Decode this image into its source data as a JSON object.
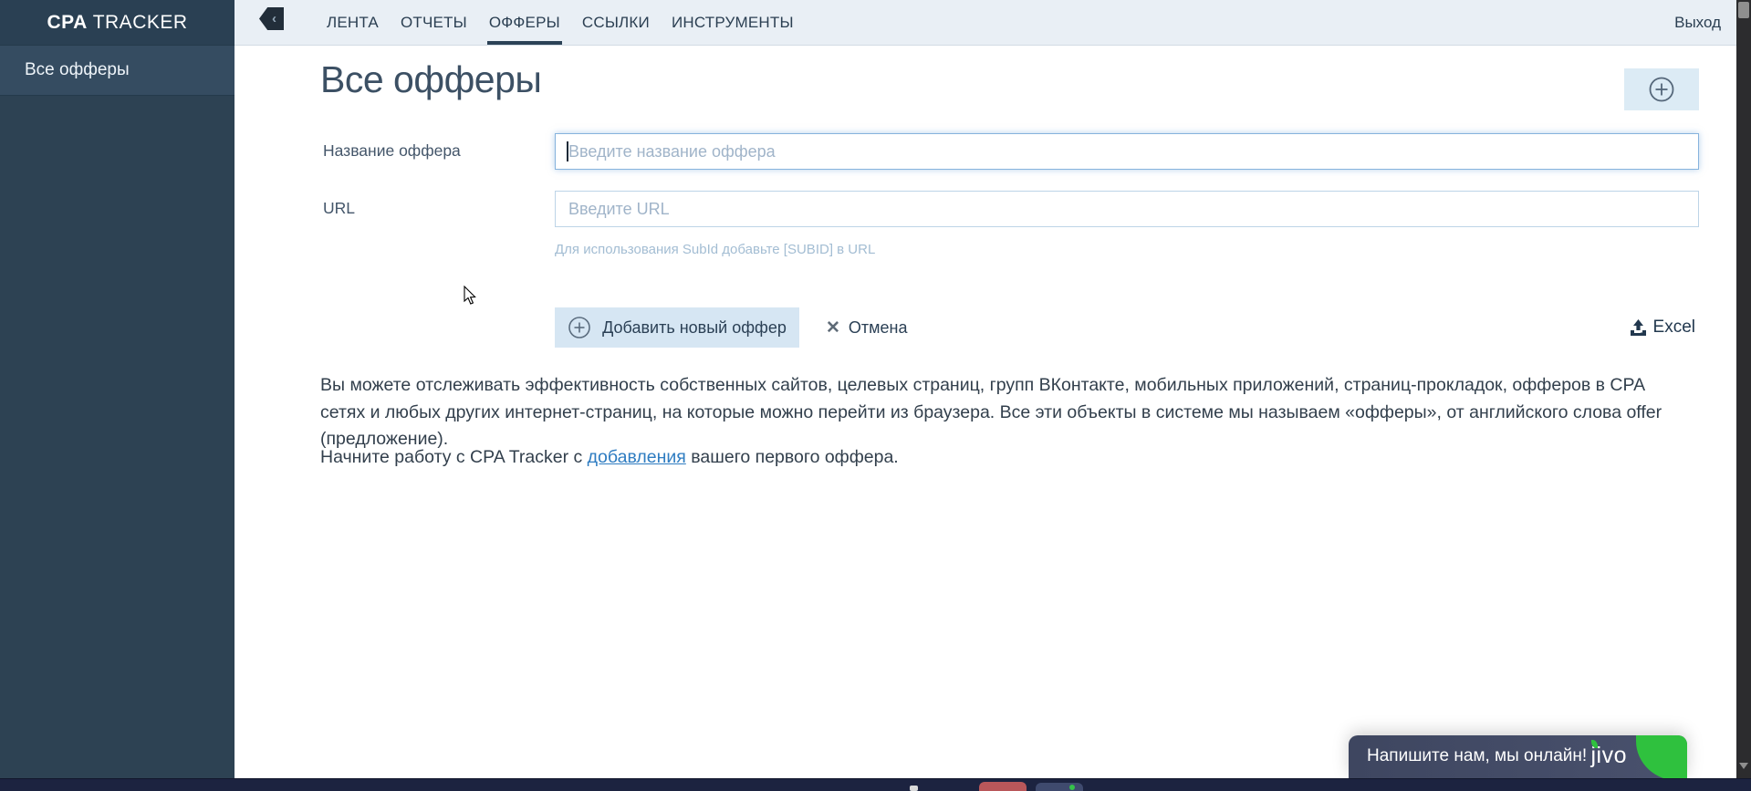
{
  "brand": {
    "bold": "CPA",
    "rest": " TRACKER",
    "collapse_glyph": "‹"
  },
  "topbar": {
    "tabs": [
      "ЛЕНТА",
      "ОТЧЕТЫ",
      "ОФФЕРЫ",
      "ССЫЛКИ",
      "ИНСТРУМЕНТЫ"
    ],
    "active_tab": "ОФФЕРЫ",
    "logout_label": "Выход"
  },
  "sidebar": {
    "items": [
      {
        "label": "Все офферы",
        "active": true
      }
    ]
  },
  "page": {
    "title": "Все офферы",
    "form": {
      "name_label": "Название оффера",
      "name_placeholder": "Введите название оффера",
      "name_value": "",
      "url_label": "URL",
      "url_placeholder": "Введите URL",
      "url_value": "",
      "url_hint": "Для использования SubId добавьте [SUBID] в URL",
      "submit_label": "Добавить новый оффер",
      "cancel_label": "Отмена",
      "cancel_glyph": "✕",
      "excel_label": "Excel"
    },
    "intro_text": "Вы можете отслеживать эффективность собственных сайтов, целевых страниц, групп ВКонтакте, мобильных приложений, страниц-прокладок, офферов в CPA сетях и любых других интернет-страниц, на которые можно перейти из браузера. Все эти объекты в системе мы называем «офферы», от английского слова offer (предложение).",
    "start_text_before": "Начните работу с CPA Tracker с ",
    "start_link_text": "добавления",
    "start_text_after": " вашего первого оффера."
  },
  "chat_widget": {
    "message": "Напишите нам, мы онлайн!",
    "brand": "jivo"
  },
  "colors": {
    "sidebar_bg": "#2d4253",
    "sidebar_active_bg": "#354c61",
    "topbar_bg": "#e9eff5",
    "accent_navy": "#2c4257",
    "link_blue": "#2e7cc1",
    "button_bg": "#d6e6f3",
    "focus_border": "#86b3dd",
    "jivo_green": "#2fc13e"
  }
}
